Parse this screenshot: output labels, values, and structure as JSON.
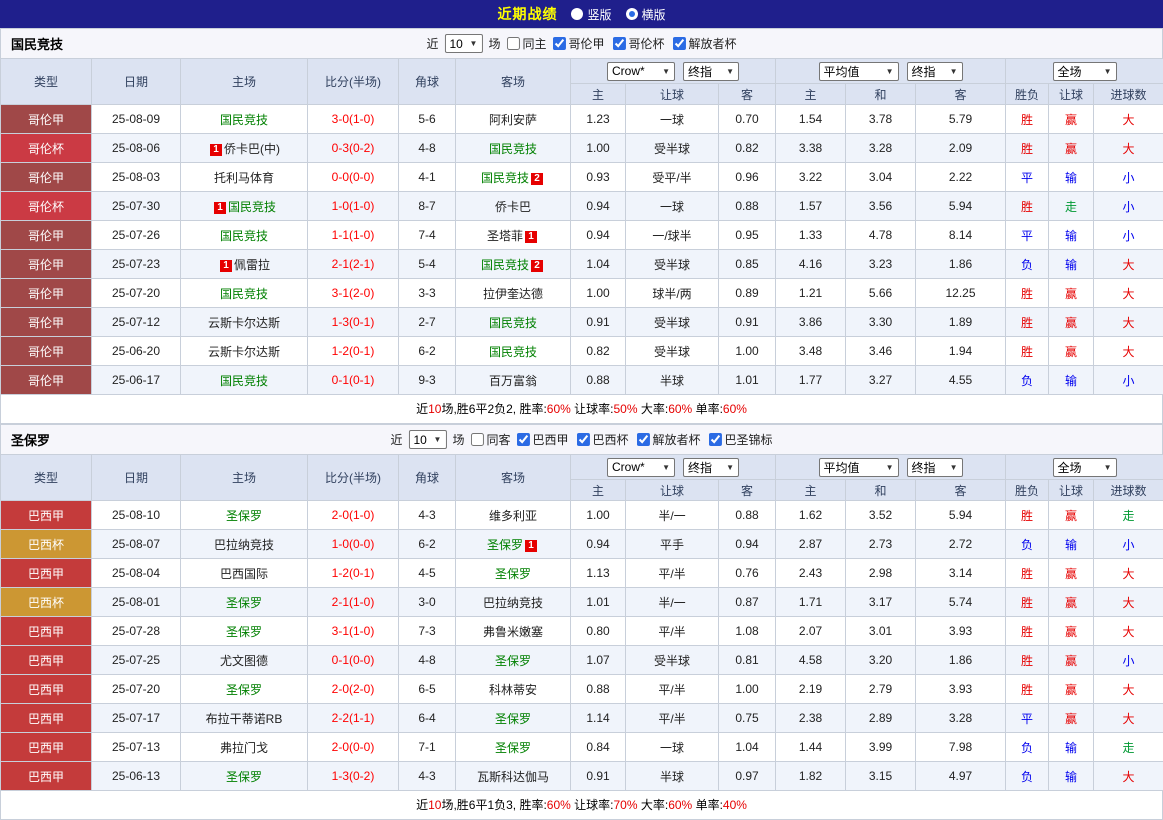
{
  "topbar": {
    "title": "近期战绩",
    "radios": [
      {
        "label": "竖版",
        "checked": false
      },
      {
        "label": "横版",
        "checked": true
      }
    ]
  },
  "labels": {
    "near": "近",
    "games": "场"
  },
  "table_header": {
    "cols": [
      "类型",
      "日期",
      "主场",
      "比分(半场)",
      "角球",
      "客场"
    ],
    "subcols": [
      "主",
      "让球",
      "客",
      "主",
      "和",
      "客",
      "胜负",
      "让球",
      "进球数"
    ],
    "selects": [
      "Crow*",
      "终指",
      "平均值",
      "终指",
      "全场"
    ]
  },
  "palette": {
    "colombia_league": "#A04848",
    "colombia_cup": "#CB3A44",
    "brazil_league": "#C43B3B",
    "brazil_cup": "#CC9733",
    "topbar_bg": "#1F1F8C",
    "title_yellow": "#FFFF00",
    "team_green": "#008000",
    "score_red": "#FF0000",
    "win_red": "#E60000",
    "lose_blue": "#0000EE",
    "walk_green": "#009933",
    "header_bg": "#DCE3F2"
  },
  "sections": [
    {
      "team": "国民竞技",
      "filter": {
        "count": "10",
        "same_label": "同主",
        "same_checked": false,
        "leagues": [
          {
            "label": "哥伦甲",
            "checked": true
          },
          {
            "label": "哥伦杯",
            "checked": true
          },
          {
            "label": "解放者杯",
            "checked": true
          }
        ]
      },
      "rows": [
        {
          "league": "哥伦甲",
          "league_color": "colombia_league",
          "date": "25-08-09",
          "home": {
            "name": "国民竞技",
            "green": true
          },
          "score": "3-0(1-0)",
          "corners": "5-6",
          "away": {
            "name": "阿利安萨",
            "green": false
          },
          "odds": [
            "1.23",
            "一球",
            "0.70",
            "1.54",
            "3.78",
            "5.79"
          ],
          "results": [
            [
              "胜",
              "red"
            ],
            [
              "赢",
              "red"
            ],
            [
              "大",
              "red"
            ]
          ]
        },
        {
          "league": "哥伦杯",
          "league_color": "colombia_cup",
          "date": "25-08-06",
          "home": {
            "name": "侨卡巴(中)",
            "green": false,
            "badge": "1"
          },
          "score": "0-3(0-2)",
          "corners": "4-8",
          "away": {
            "name": "国民竞技",
            "green": true
          },
          "odds": [
            "1.00",
            "受半球",
            "0.82",
            "3.38",
            "3.28",
            "2.09"
          ],
          "results": [
            [
              "胜",
              "red"
            ],
            [
              "赢",
              "red"
            ],
            [
              "大",
              "red"
            ]
          ]
        },
        {
          "league": "哥伦甲",
          "league_color": "colombia_league",
          "date": "25-08-03",
          "home": {
            "name": "托利马体育",
            "green": false
          },
          "score": "0-0(0-0)",
          "corners": "4-1",
          "away": {
            "name": "国民竞技",
            "green": true,
            "badge": "2"
          },
          "odds": [
            "0.93",
            "受平/半",
            "0.96",
            "3.22",
            "3.04",
            "2.22"
          ],
          "results": [
            [
              "平",
              "blue"
            ],
            [
              "输",
              "blue"
            ],
            [
              "小",
              "blue"
            ]
          ]
        },
        {
          "league": "哥伦杯",
          "league_color": "colombia_cup",
          "date": "25-07-30",
          "home": {
            "name": "国民竞技",
            "green": true,
            "badge": "1"
          },
          "score": "1-0(1-0)",
          "corners": "8-7",
          "away": {
            "name": "侨卡巴",
            "green": false
          },
          "odds": [
            "0.94",
            "一球",
            "0.88",
            "1.57",
            "3.56",
            "5.94"
          ],
          "results": [
            [
              "胜",
              "red"
            ],
            [
              "走",
              "green"
            ],
            [
              "小",
              "blue"
            ]
          ]
        },
        {
          "league": "哥伦甲",
          "league_color": "colombia_league",
          "date": "25-07-26",
          "home": {
            "name": "国民竞技",
            "green": true
          },
          "score": "1-1(1-0)",
          "corners": "7-4",
          "away": {
            "name": "圣塔菲",
            "green": false,
            "badge": "1"
          },
          "odds": [
            "0.94",
            "一/球半",
            "0.95",
            "1.33",
            "4.78",
            "8.14"
          ],
          "results": [
            [
              "平",
              "blue"
            ],
            [
              "输",
              "blue"
            ],
            [
              "小",
              "blue"
            ]
          ]
        },
        {
          "league": "哥伦甲",
          "league_color": "colombia_league",
          "date": "25-07-23",
          "home": {
            "name": "佩雷拉",
            "green": false,
            "badge": "1"
          },
          "score": "2-1(2-1)",
          "corners": "5-4",
          "away": {
            "name": "国民竞技",
            "green": true,
            "badge": "2"
          },
          "odds": [
            "1.04",
            "受半球",
            "0.85",
            "4.16",
            "3.23",
            "1.86"
          ],
          "results": [
            [
              "负",
              "blue"
            ],
            [
              "输",
              "blue"
            ],
            [
              "大",
              "red"
            ]
          ]
        },
        {
          "league": "哥伦甲",
          "league_color": "colombia_league",
          "date": "25-07-20",
          "home": {
            "name": "国民竞技",
            "green": true
          },
          "score": "3-1(2-0)",
          "corners": "3-3",
          "away": {
            "name": "拉伊奎达德",
            "green": false
          },
          "odds": [
            "1.00",
            "球半/两",
            "0.89",
            "1.21",
            "5.66",
            "12.25"
          ],
          "results": [
            [
              "胜",
              "red"
            ],
            [
              "赢",
              "red"
            ],
            [
              "大",
              "red"
            ]
          ]
        },
        {
          "league": "哥伦甲",
          "league_color": "colombia_league",
          "date": "25-07-12",
          "home": {
            "name": "云斯卡尔达斯",
            "green": false
          },
          "score": "1-3(0-1)",
          "corners": "2-7",
          "away": {
            "name": "国民竞技",
            "green": true
          },
          "odds": [
            "0.91",
            "受半球",
            "0.91",
            "3.86",
            "3.30",
            "1.89"
          ],
          "results": [
            [
              "胜",
              "red"
            ],
            [
              "赢",
              "red"
            ],
            [
              "大",
              "red"
            ]
          ]
        },
        {
          "league": "哥伦甲",
          "league_color": "colombia_league",
          "date": "25-06-20",
          "home": {
            "name": "云斯卡尔达斯",
            "green": false
          },
          "score": "1-2(0-1)",
          "corners": "6-2",
          "away": {
            "name": "国民竞技",
            "green": true
          },
          "odds": [
            "0.82",
            "受半球",
            "1.00",
            "3.48",
            "3.46",
            "1.94"
          ],
          "results": [
            [
              "胜",
              "red"
            ],
            [
              "赢",
              "red"
            ],
            [
              "大",
              "red"
            ]
          ]
        },
        {
          "league": "哥伦甲",
          "league_color": "colombia_league",
          "date": "25-06-17",
          "home": {
            "name": "国民竞技",
            "green": true
          },
          "score": "0-1(0-1)",
          "corners": "9-3",
          "away": {
            "name": "百万富翁",
            "green": false
          },
          "odds": [
            "0.88",
            "半球",
            "1.01",
            "1.77",
            "3.27",
            "4.55"
          ],
          "results": [
            [
              "负",
              "blue"
            ],
            [
              "输",
              "blue"
            ],
            [
              "小",
              "blue"
            ]
          ]
        }
      ],
      "stats": [
        [
          "近",
          "black"
        ],
        [
          "10",
          "red"
        ],
        [
          "场,胜6平2负2, 胜率:",
          "black"
        ],
        [
          "60%",
          "red"
        ],
        [
          " 让球率:",
          "black"
        ],
        [
          "50%",
          "red"
        ],
        [
          " 大率:",
          "black"
        ],
        [
          "60%",
          "red"
        ],
        [
          " 单率:",
          "black"
        ],
        [
          "60%",
          "red"
        ]
      ]
    },
    {
      "team": "圣保罗",
      "filter": {
        "count": "10",
        "same_label": "同客",
        "same_checked": false,
        "leagues": [
          {
            "label": "巴西甲",
            "checked": true
          },
          {
            "label": "巴西杯",
            "checked": true
          },
          {
            "label": "解放者杯",
            "checked": true
          },
          {
            "label": "巴圣锦标",
            "checked": true
          }
        ]
      },
      "rows": [
        {
          "league": "巴西甲",
          "league_color": "brazil_league",
          "date": "25-08-10",
          "home": {
            "name": "圣保罗",
            "green": true
          },
          "score": "2-0(1-0)",
          "corners": "4-3",
          "away": {
            "name": "维多利亚",
            "green": false
          },
          "odds": [
            "1.00",
            "半/一",
            "0.88",
            "1.62",
            "3.52",
            "5.94"
          ],
          "results": [
            [
              "胜",
              "red"
            ],
            [
              "赢",
              "red"
            ],
            [
              "走",
              "green"
            ]
          ]
        },
        {
          "league": "巴西杯",
          "league_color": "brazil_cup",
          "date": "25-08-07",
          "home": {
            "name": "巴拉纳竞技",
            "green": false
          },
          "score": "1-0(0-0)",
          "corners": "6-2",
          "away": {
            "name": "圣保罗",
            "green": true,
            "badge": "1"
          },
          "odds": [
            "0.94",
            "平手",
            "0.94",
            "2.87",
            "2.73",
            "2.72"
          ],
          "results": [
            [
              "负",
              "blue"
            ],
            [
              "输",
              "blue"
            ],
            [
              "小",
              "blue"
            ]
          ]
        },
        {
          "league": "巴西甲",
          "league_color": "brazil_league",
          "date": "25-08-04",
          "home": {
            "name": "巴西国际",
            "green": false
          },
          "score": "1-2(0-1)",
          "corners": "4-5",
          "away": {
            "name": "圣保罗",
            "green": true
          },
          "odds": [
            "1.13",
            "平/半",
            "0.76",
            "2.43",
            "2.98",
            "3.14"
          ],
          "results": [
            [
              "胜",
              "red"
            ],
            [
              "赢",
              "red"
            ],
            [
              "大",
              "red"
            ]
          ]
        },
        {
          "league": "巴西杯",
          "league_color": "brazil_cup",
          "date": "25-08-01",
          "home": {
            "name": "圣保罗",
            "green": true
          },
          "score": "2-1(1-0)",
          "corners": "3-0",
          "away": {
            "name": "巴拉纳竞技",
            "green": false
          },
          "odds": [
            "1.01",
            "半/一",
            "0.87",
            "1.71",
            "3.17",
            "5.74"
          ],
          "results": [
            [
              "胜",
              "red"
            ],
            [
              "赢",
              "red"
            ],
            [
              "大",
              "red"
            ]
          ]
        },
        {
          "league": "巴西甲",
          "league_color": "brazil_league",
          "date": "25-07-28",
          "home": {
            "name": "圣保罗",
            "green": true
          },
          "score": "3-1(1-0)",
          "corners": "7-3",
          "away": {
            "name": "弗鲁米嫩塞",
            "green": false
          },
          "odds": [
            "0.80",
            "平/半",
            "1.08",
            "2.07",
            "3.01",
            "3.93"
          ],
          "results": [
            [
              "胜",
              "red"
            ],
            [
              "赢",
              "red"
            ],
            [
              "大",
              "red"
            ]
          ]
        },
        {
          "league": "巴西甲",
          "league_color": "brazil_league",
          "date": "25-07-25",
          "home": {
            "name": "尤文图德",
            "green": false
          },
          "score": "0-1(0-0)",
          "corners": "4-8",
          "away": {
            "name": "圣保罗",
            "green": true
          },
          "odds": [
            "1.07",
            "受半球",
            "0.81",
            "4.58",
            "3.20",
            "1.86"
          ],
          "results": [
            [
              "胜",
              "red"
            ],
            [
              "赢",
              "red"
            ],
            [
              "小",
              "blue"
            ]
          ]
        },
        {
          "league": "巴西甲",
          "league_color": "brazil_league",
          "date": "25-07-20",
          "home": {
            "name": "圣保罗",
            "green": true
          },
          "score": "2-0(2-0)",
          "corners": "6-5",
          "away": {
            "name": "科林蒂安",
            "green": false
          },
          "odds": [
            "0.88",
            "平/半",
            "1.00",
            "2.19",
            "2.79",
            "3.93"
          ],
          "results": [
            [
              "胜",
              "red"
            ],
            [
              "赢",
              "red"
            ],
            [
              "大",
              "red"
            ]
          ]
        },
        {
          "league": "巴西甲",
          "league_color": "brazil_league",
          "date": "25-07-17",
          "home": {
            "name": "布拉干蒂诺RB",
            "green": false
          },
          "score": "2-2(1-1)",
          "corners": "6-4",
          "away": {
            "name": "圣保罗",
            "green": true
          },
          "odds": [
            "1.14",
            "平/半",
            "0.75",
            "2.38",
            "2.89",
            "3.28"
          ],
          "results": [
            [
              "平",
              "blue"
            ],
            [
              "赢",
              "red"
            ],
            [
              "大",
              "red"
            ]
          ]
        },
        {
          "league": "巴西甲",
          "league_color": "brazil_league",
          "date": "25-07-13",
          "home": {
            "name": "弗拉门戈",
            "green": false
          },
          "score": "2-0(0-0)",
          "corners": "7-1",
          "away": {
            "name": "圣保罗",
            "green": true
          },
          "odds": [
            "0.84",
            "一球",
            "1.04",
            "1.44",
            "3.99",
            "7.98"
          ],
          "results": [
            [
              "负",
              "blue"
            ],
            [
              "输",
              "blue"
            ],
            [
              "走",
              "green"
            ]
          ]
        },
        {
          "league": "巴西甲",
          "league_color": "brazil_league",
          "date": "25-06-13",
          "home": {
            "name": "圣保罗",
            "green": true
          },
          "score": "1-3(0-2)",
          "corners": "4-3",
          "away": {
            "name": "瓦斯科达伽马",
            "green": false
          },
          "odds": [
            "0.91",
            "半球",
            "0.97",
            "1.82",
            "3.15",
            "4.97"
          ],
          "results": [
            [
              "负",
              "blue"
            ],
            [
              "输",
              "blue"
            ],
            [
              "大",
              "red"
            ]
          ]
        }
      ],
      "stats": [
        [
          "近",
          "black"
        ],
        [
          "10",
          "red"
        ],
        [
          "场,胜6平1负3, 胜率:",
          "black"
        ],
        [
          "60%",
          "red"
        ],
        [
          " 让球率:",
          "black"
        ],
        [
          "70%",
          "red"
        ],
        [
          " 大率:",
          "black"
        ],
        [
          "60%",
          "red"
        ],
        [
          " 单率:",
          "black"
        ],
        [
          "40%",
          "red"
        ]
      ]
    }
  ]
}
